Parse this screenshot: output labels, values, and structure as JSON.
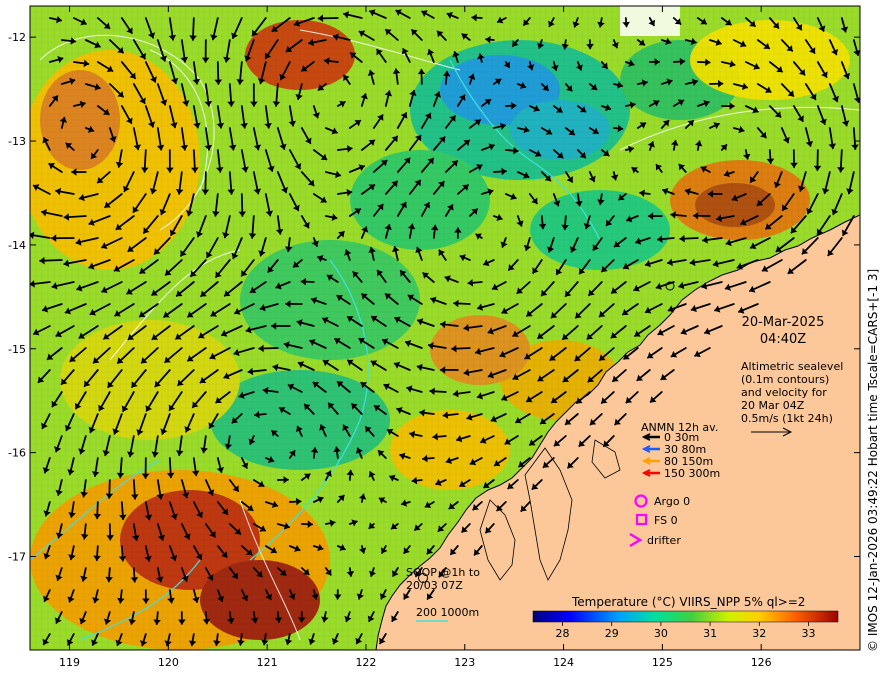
{
  "axes": {
    "x_ticks": [
      "119",
      "120",
      "121",
      "122",
      "123",
      "124",
      "125",
      "126"
    ],
    "y_ticks": [
      "-12",
      "-13",
      "-14",
      "-15",
      "-16",
      "-17"
    ],
    "lon_range": [
      118.6,
      127.0
    ],
    "lat_range": [
      -17.9,
      -11.7
    ]
  },
  "date": {
    "day": "20-Mar-2025",
    "time": "04:40Z"
  },
  "altimetry": {
    "lines": [
      "Altimetric sealevel",
      "(0.1m contours)",
      "and velocity for",
      "20 Mar 04Z",
      "0.5m/s (1kt 24h)"
    ]
  },
  "anmn_legend": {
    "title": "ANMN 12h av.",
    "items": [
      {
        "label": "0 30m",
        "color": "#000000"
      },
      {
        "label": "30 80m",
        "color": "#1e5aff"
      },
      {
        "label": "80 150m",
        "color": "#ffa000"
      },
      {
        "label": "150 300m",
        "color": "#ff0000"
      }
    ]
  },
  "markers": {
    "argo": "Argo 0",
    "fs": "FS 0",
    "drifter": "drifter",
    "marker_color": "#ff00ff"
  },
  "soop": {
    "line1": "SOOP @1h to",
    "line2": "20/03 07Z"
  },
  "bathymetry": {
    "label": "200  1000m",
    "line_color": "#40e0e0"
  },
  "colorbar": {
    "title": "Temperature (°C) VIIRS_NPP 5% ql>=2",
    "ticks": [
      "28",
      "29",
      "30",
      "31",
      "32",
      "33"
    ],
    "range": [
      27.4,
      33.6
    ]
  },
  "credit": "© IMOS 12-Jan-2026 03:49:22 Hobart time Tscale=CARS+[-1 3]",
  "colors": {
    "land": "#fcc89a",
    "coast": "#000000"
  }
}
